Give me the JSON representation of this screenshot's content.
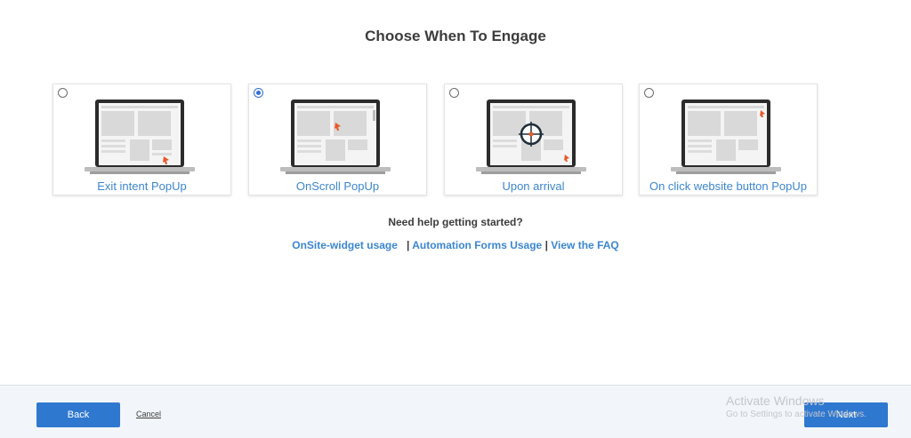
{
  "header": {
    "title": "Choose When To Engage"
  },
  "options": [
    {
      "label": "Exit intent PopUp",
      "checked": false,
      "icon": "laptop-exit-cursor-icon"
    },
    {
      "label": "OnScroll PopUp",
      "checked": true,
      "icon": "laptop-scroll-cursor-icon"
    },
    {
      "label": "Upon arrival",
      "checked": false,
      "icon": "laptop-target-icon"
    },
    {
      "label": "On click website button PopUp",
      "checked": false,
      "icon": "laptop-click-cursor-icon"
    }
  ],
  "help": {
    "title": "Need help getting started?",
    "link_onsite": "OnSite-widget usage",
    "separator": "|",
    "link_automation": "Automation Forms Usage",
    "link_faq": "View the FAQ"
  },
  "footer": {
    "back_label": "Back",
    "cancel_label": "Cancel",
    "next_label": "Next",
    "watermark_line1": "Activate Windows",
    "watermark_line2": "Go to Settings to activate Windows."
  },
  "colors": {
    "accent": "#2f78d0",
    "link": "#3c86d0",
    "cursor": "#e8582a"
  }
}
